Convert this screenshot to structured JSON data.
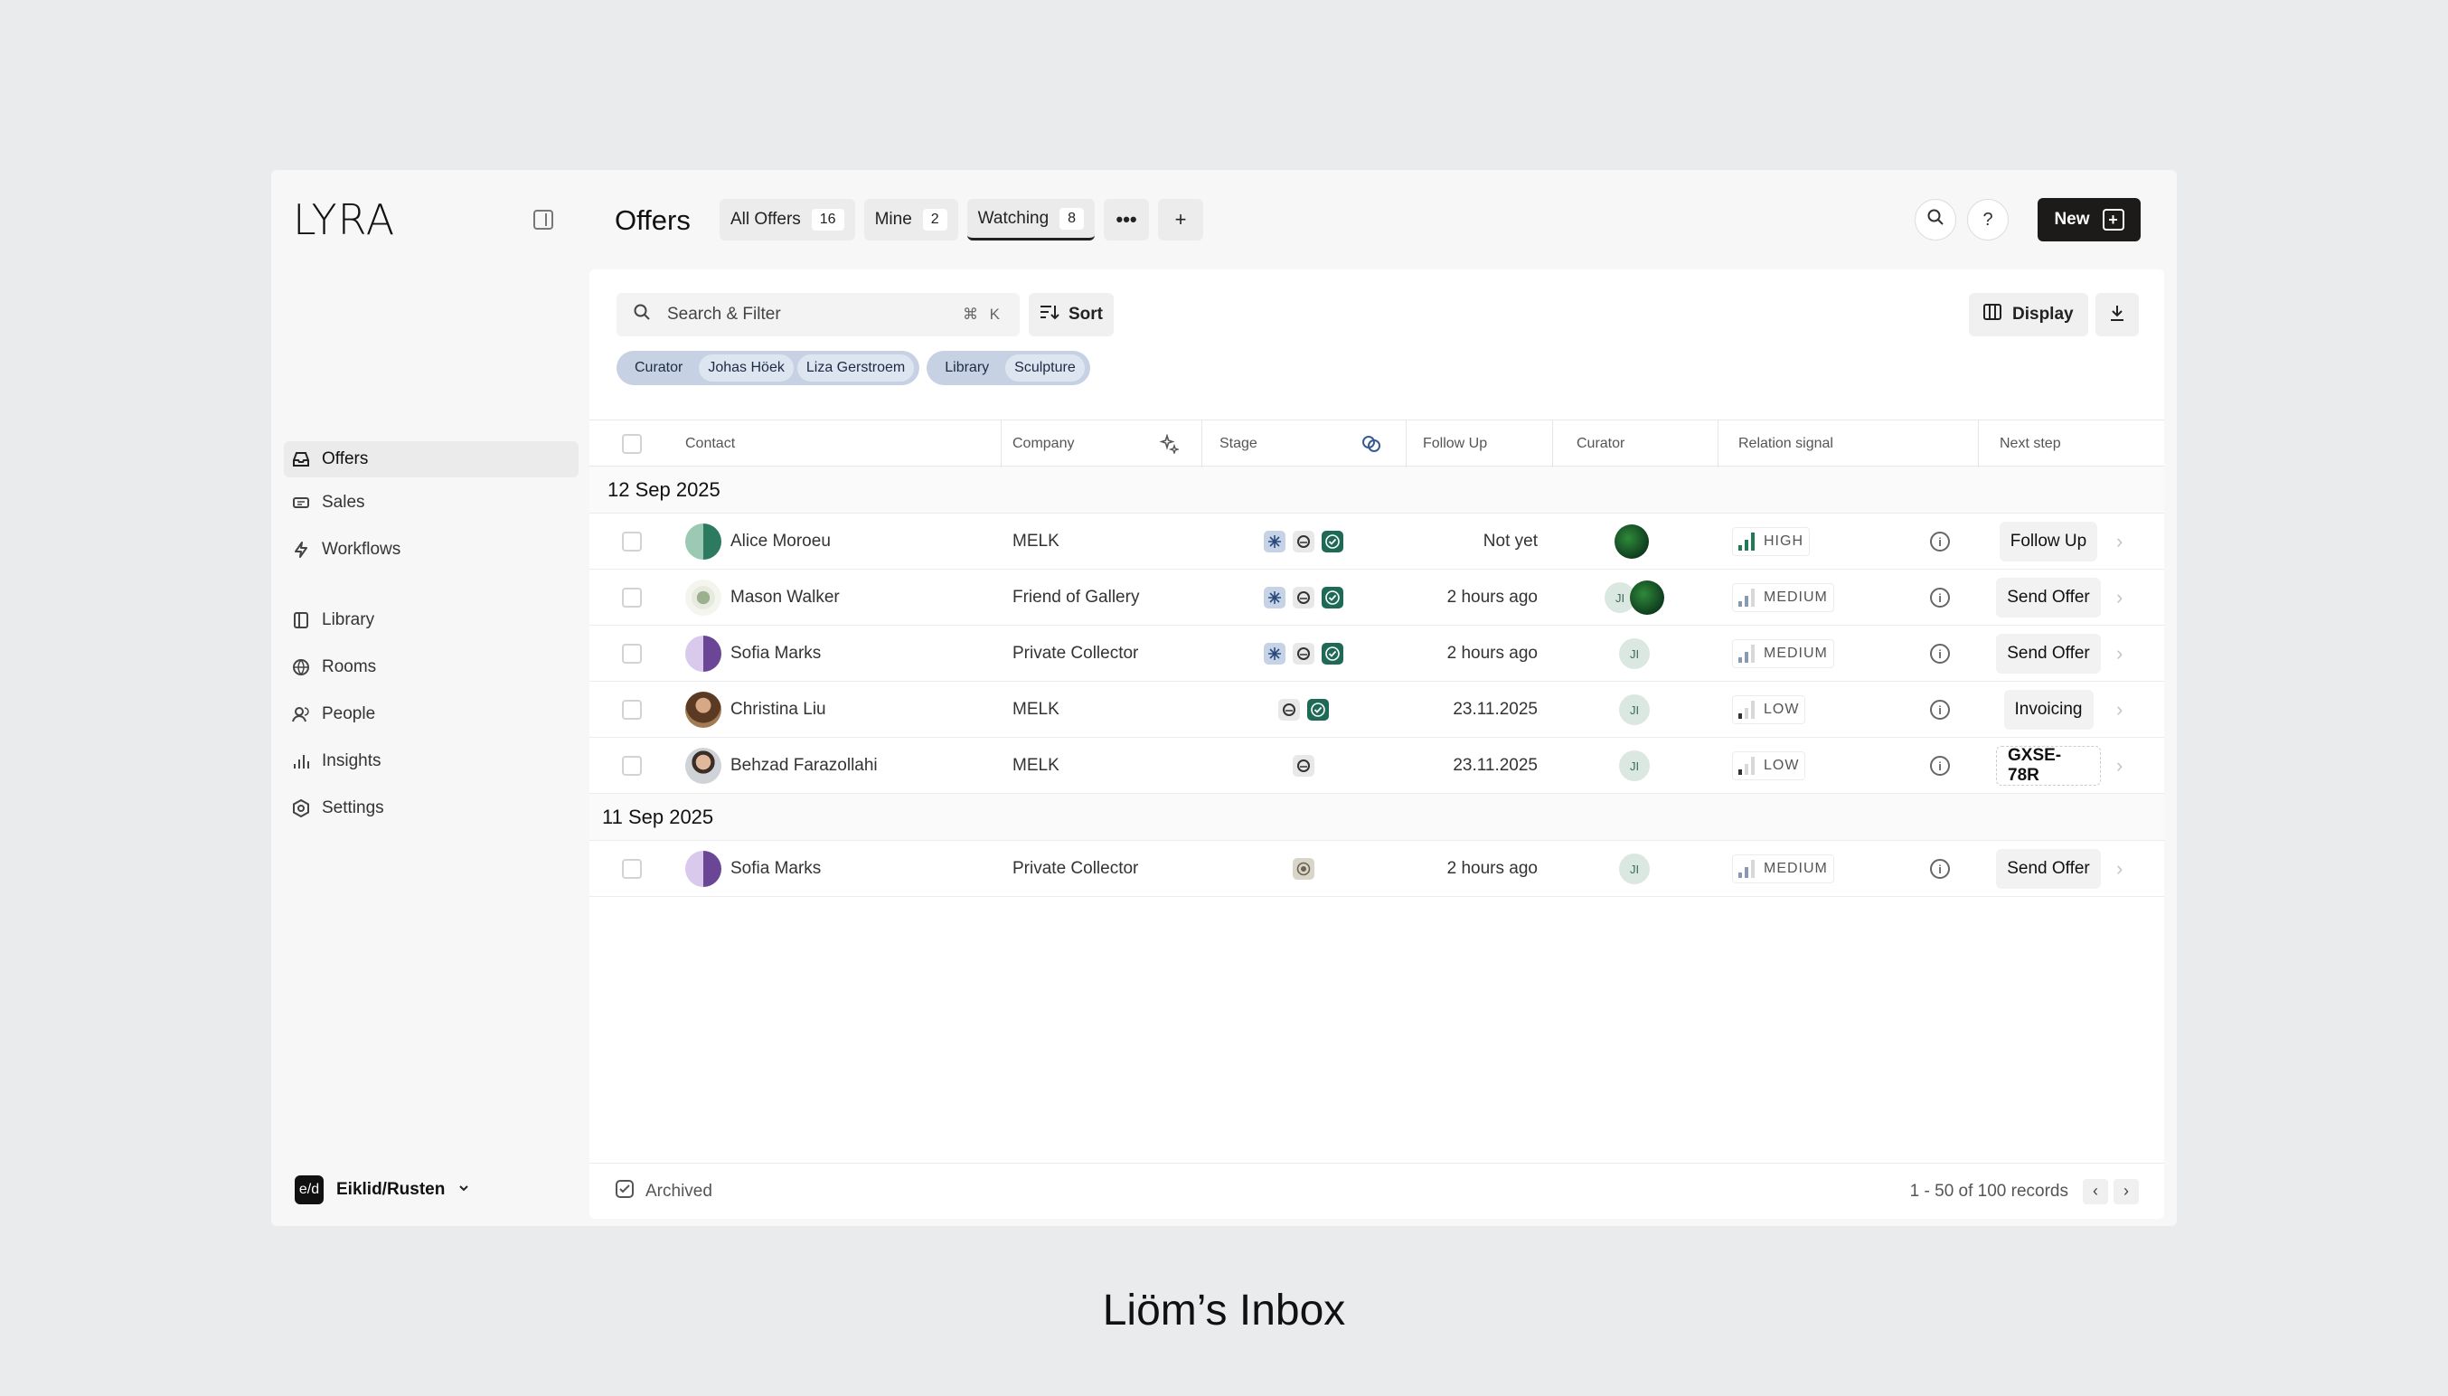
{
  "app": {
    "logo": "LYRA",
    "org": {
      "badge": "e/d",
      "name": "Eiklid/Rusten"
    }
  },
  "sidebar": {
    "items": [
      {
        "label": "Offers",
        "icon": "inbox-icon"
      },
      {
        "label": "Sales",
        "icon": "ticket-icon"
      },
      {
        "label": "Workflows",
        "icon": "bolt-icon"
      },
      {
        "label": "Library",
        "icon": "book-icon"
      },
      {
        "label": "Rooms",
        "icon": "globe-icon"
      },
      {
        "label": "People",
        "icon": "people-icon"
      },
      {
        "label": "Insights",
        "icon": "bar-chart-icon"
      },
      {
        "label": "Settings",
        "icon": "settings-icon"
      }
    ]
  },
  "header": {
    "title": "Offers",
    "tabs": [
      {
        "label": "All Offers",
        "count": "16"
      },
      {
        "label": "Mine",
        "count": "2"
      },
      {
        "label": "Watching",
        "count": "8"
      }
    ],
    "more_label": "•••",
    "add_label": "+",
    "help_label": "?",
    "new_label": "New"
  },
  "toolbar": {
    "search_placeholder": "Search & Filter",
    "search_shortcut": "⌘ K",
    "sort_label": "Sort",
    "display_label": "Display"
  },
  "filters": [
    {
      "label": "Curator",
      "values": [
        "Johas Höek",
        "Liza Gerstroem"
      ]
    },
    {
      "label": "Library",
      "values": [
        "Sculpture"
      ]
    }
  ],
  "table": {
    "columns": [
      "Contact",
      "Company",
      "Stage",
      "Follow Up",
      "Curator",
      "Relation signal",
      "Next step"
    ],
    "groups": [
      {
        "date": "12 Sep 2025",
        "rows": [
          {
            "contact": "Alice Moroeu",
            "avatar": "green",
            "company": "MELK",
            "stages": [
              "spark",
              "ring",
              "check"
            ],
            "follow_up": "Not yet",
            "curator": [
              "img"
            ],
            "signal": "HIGH",
            "level": 3,
            "next": "Follow Up",
            "next_style": "btn"
          },
          {
            "contact": "Mason Walker",
            "avatar": "flower",
            "company": "Friend of Gallery",
            "stages": [
              "spark",
              "ring",
              "check"
            ],
            "follow_up": "2 hours ago",
            "curator": [
              "JI",
              "img"
            ],
            "signal": "MEDIUM",
            "level": 2,
            "next": "Send Offer",
            "next_style": "btn"
          },
          {
            "contact": "Sofia Marks",
            "avatar": "purple",
            "company": "Private Collector",
            "stages": [
              "spark",
              "ring",
              "check"
            ],
            "follow_up": "2 hours ago",
            "curator": [
              "JI"
            ],
            "signal": "MEDIUM",
            "level": 2,
            "next": "Send Offer",
            "next_style": "btn"
          },
          {
            "contact": "Christina Liu",
            "avatar": "photo-woman",
            "company": "MELK",
            "stages": [
              "ring",
              "check"
            ],
            "follow_up": "23.11.2025",
            "curator": [
              "JI"
            ],
            "signal": "LOW",
            "level": 1,
            "next": "Invoicing",
            "next_style": "btn"
          },
          {
            "contact": "Behzad Farazollahi",
            "avatar": "photo-man",
            "company": "MELK",
            "stages": [
              "ring"
            ],
            "follow_up": "23.11.2025",
            "curator": [
              "JI"
            ],
            "signal": "LOW",
            "level": 1,
            "next": "GXSE-78R",
            "next_style": "code"
          }
        ]
      },
      {
        "date": "11 Sep 2025",
        "rows": [
          {
            "contact": "Sofia Marks",
            "avatar": "purple",
            "company": "Private Collector",
            "stages": [
              "target"
            ],
            "follow_up": "2 hours ago",
            "curator": [
              "JI"
            ],
            "signal": "MEDIUM",
            "level": 2,
            "next": "Send Offer",
            "next_style": "btn"
          }
        ]
      }
    ]
  },
  "footer": {
    "archived_label": "Archived",
    "records": "1 - 50 of 100 records"
  },
  "caption": "Liöm’s Inbox",
  "colors": {
    "accent_dark": "#1c1b19",
    "chip": "#c6d2e4",
    "high": "#1f7a55",
    "medium": "#8899b2"
  }
}
